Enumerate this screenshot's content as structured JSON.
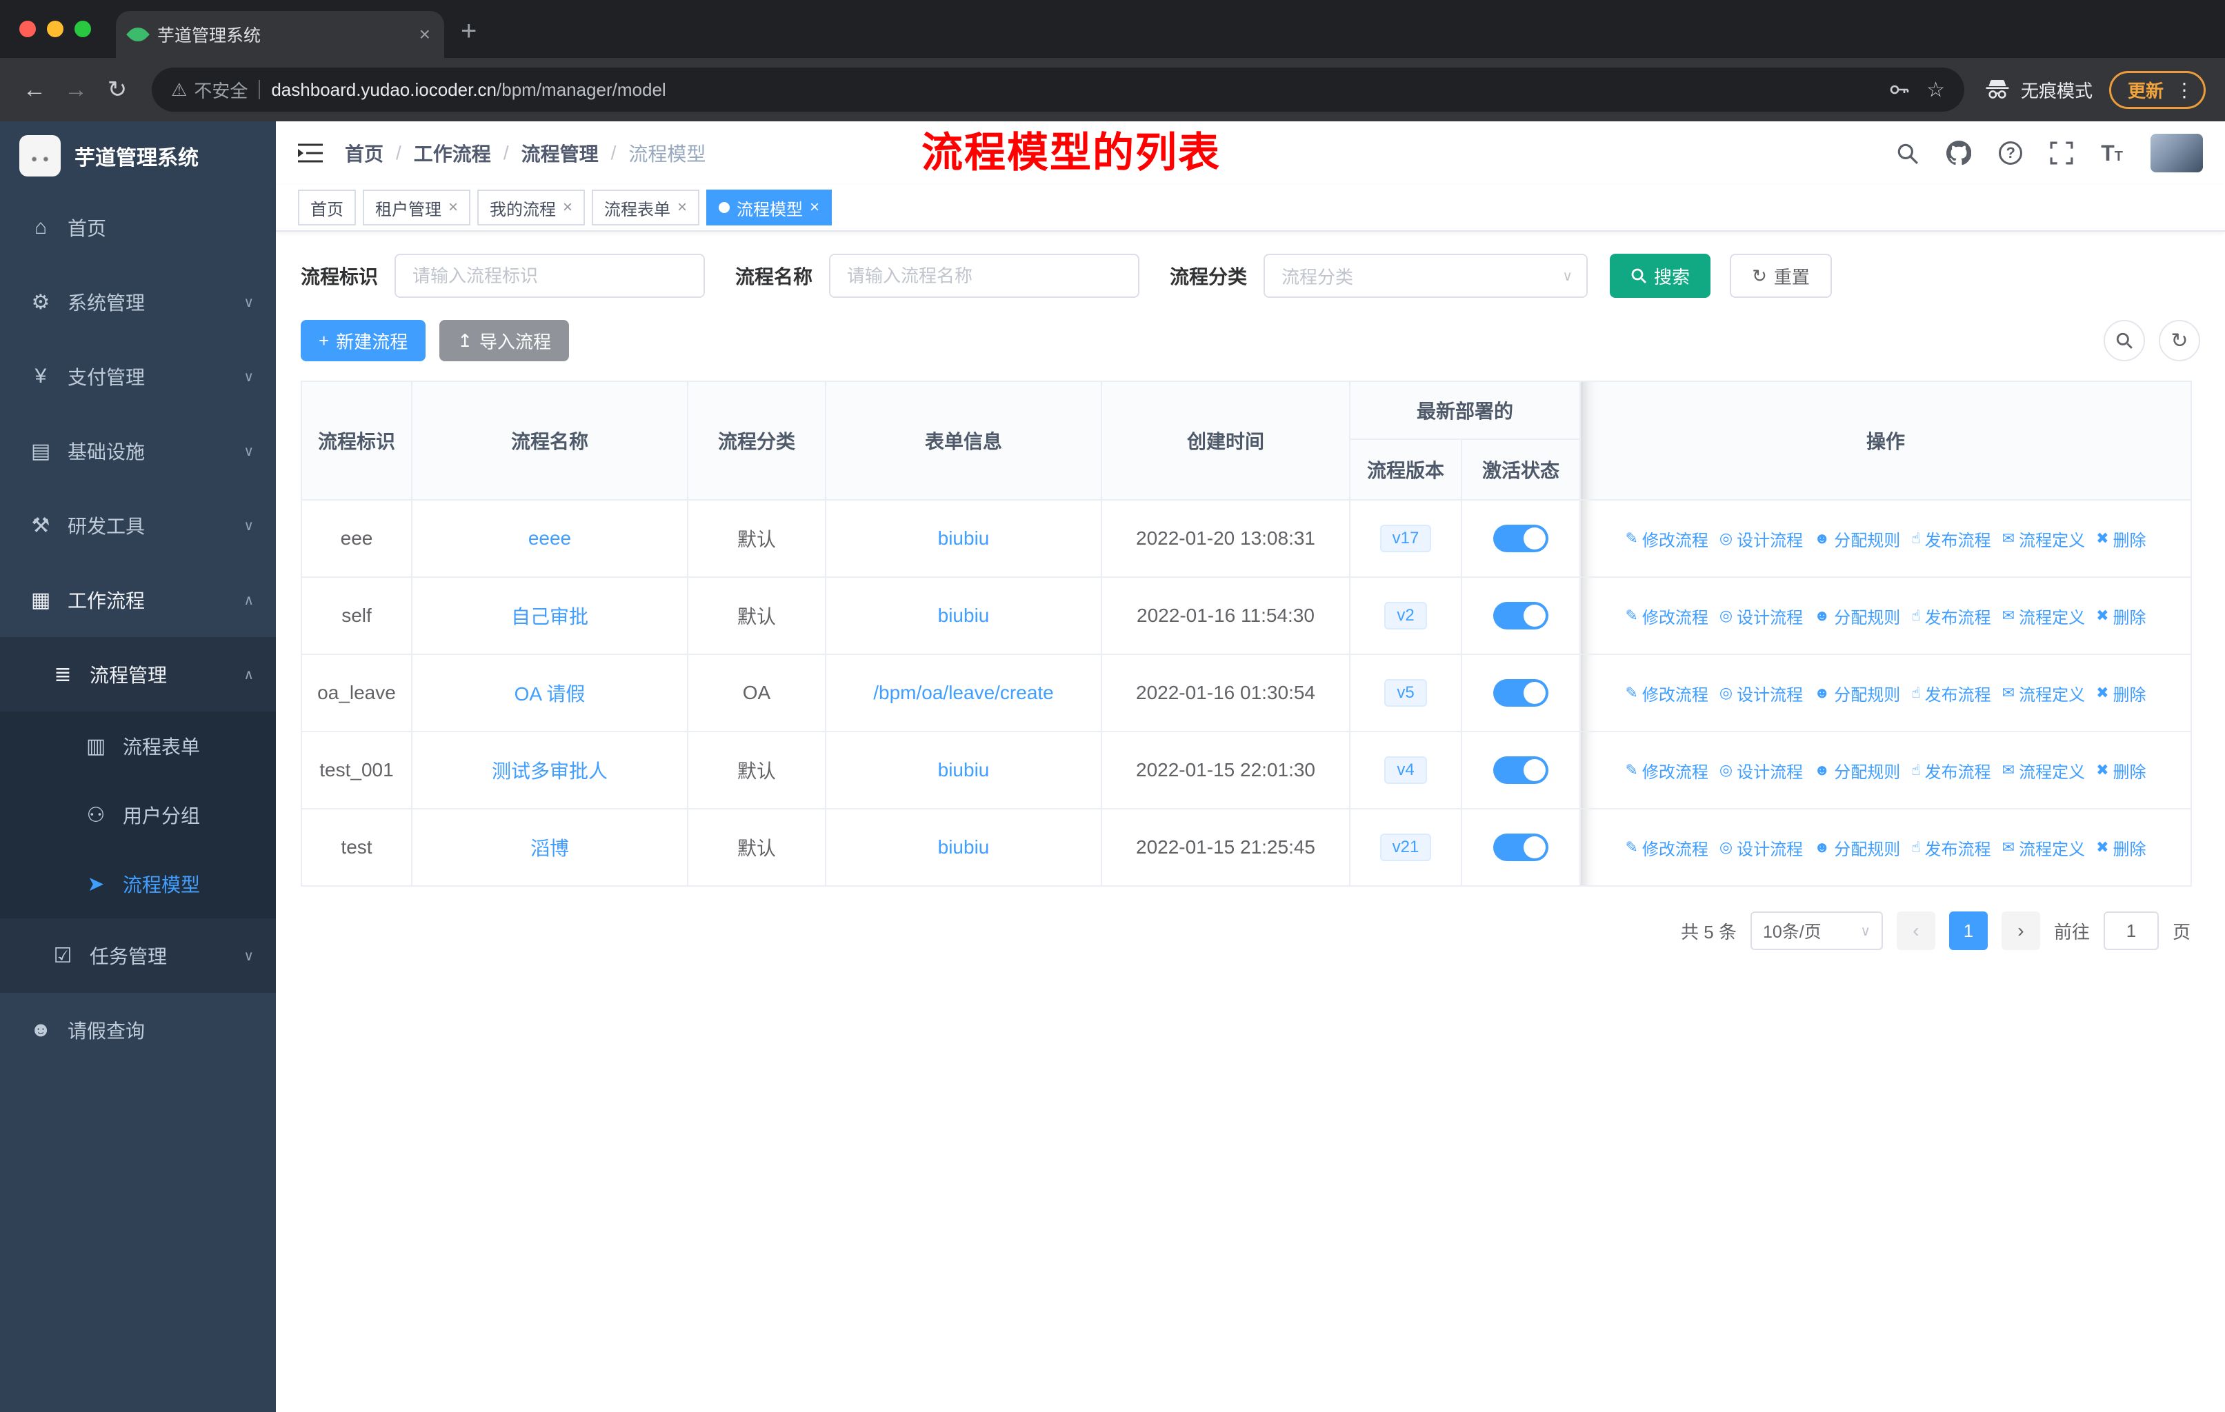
{
  "colors": {
    "accent": "#409eff",
    "search_button": "#11a983",
    "annotation_red": "#ff0000",
    "sidebar_bg": "#304156",
    "import_button": "#909399",
    "version_badge_bg": "#ecf5ff"
  },
  "browser": {
    "tab_title": "芋道管理系统",
    "security_label": "不安全",
    "url_host": "dashboard.yudao.iocoder.cn",
    "url_path": "/bpm/manager/model",
    "incognito_label": "无痕模式",
    "update_label": "更新"
  },
  "icons": {
    "back": "←",
    "forward": "→",
    "reload": "↻",
    "warning": "⚠",
    "star": "☆",
    "new_tab": "+",
    "tab_close": "×",
    "menu_dots": "⋮",
    "chevron_down": "∨",
    "chevron_up": "∧",
    "caret": "∨",
    "breadcrumb_sep": "/",
    "question": "?",
    "font_large": "T",
    "font_small": "T",
    "plus": "+",
    "upload": "↥",
    "refresh": "↻",
    "pg_prev": "‹",
    "pg_next": "›",
    "tag_close": "×"
  },
  "sidebar": {
    "logo_title": "芋道管理系统",
    "items": [
      {
        "label": "首页",
        "icon": "⌂"
      },
      {
        "label": "系统管理",
        "icon": "⚙"
      },
      {
        "label": "支付管理",
        "icon": "¥"
      },
      {
        "label": "基础设施",
        "icon": "▤"
      },
      {
        "label": "研发工具",
        "icon": "⚒"
      },
      {
        "label": "工作流程",
        "icon": "▦"
      },
      {
        "label": "流程管理",
        "icon": "≣"
      },
      {
        "label": "流程表单",
        "icon": "▥"
      },
      {
        "label": "用户分组",
        "icon": "⚇"
      },
      {
        "label": "流程模型",
        "icon": "➤"
      },
      {
        "label": "任务管理",
        "icon": "☑"
      },
      {
        "label": "请假查询",
        "icon": "☻"
      }
    ]
  },
  "header": {
    "breadcrumb": [
      "首页",
      "工作流程",
      "流程管理",
      "流程模型"
    ],
    "annotation": "流程模型的列表"
  },
  "tags": {
    "items": [
      {
        "label": "首页"
      },
      {
        "label": "租户管理"
      },
      {
        "label": "我的流程"
      },
      {
        "label": "流程表单"
      },
      {
        "label": "流程模型"
      }
    ]
  },
  "filters": {
    "id_label": "流程标识",
    "id_placeholder": "请输入流程标识",
    "name_label": "流程名称",
    "name_placeholder": "请输入流程名称",
    "category_label": "流程分类",
    "category_placeholder": "流程分类",
    "search_label": "搜索",
    "reset_label": "重置"
  },
  "toolbar": {
    "create_label": "新建流程",
    "import_label": "导入流程"
  },
  "table": {
    "headers": {
      "id": "流程标识",
      "name": "流程名称",
      "category": "流程分类",
      "form": "表单信息",
      "created": "创建时间",
      "deploy_group": "最新部署的",
      "version": "流程版本",
      "status": "激活状态",
      "ops": "操作"
    },
    "actions": [
      {
        "name": "modify-process",
        "icon": "✎",
        "label": "修改流程"
      },
      {
        "name": "design-process",
        "icon": "◎",
        "label": "设计流程"
      },
      {
        "name": "assign-rule",
        "icon": "☻",
        "label": "分配规则"
      },
      {
        "name": "publish-process",
        "icon": "☝",
        "label": "发布流程"
      },
      {
        "name": "process-definition",
        "icon": "✉",
        "label": "流程定义"
      },
      {
        "name": "delete",
        "icon": "✖",
        "label": "删除"
      }
    ],
    "rows": [
      {
        "id": "eee",
        "name": "eeee",
        "category": "默认",
        "form": "biubiu",
        "created": "2022-01-20 13:08:31",
        "version": "v17",
        "active": true
      },
      {
        "id": "self",
        "name": "自己审批",
        "category": "默认",
        "form": "biubiu",
        "created": "2022-01-16 11:54:30",
        "version": "v2",
        "active": true
      },
      {
        "id": "oa_leave",
        "name": "OA 请假",
        "category": "OA",
        "form": "/bpm/oa/leave/create",
        "created": "2022-01-16 01:30:54",
        "version": "v5",
        "active": true
      },
      {
        "id": "test_001",
        "name": "测试多审批人",
        "category": "默认",
        "form": "biubiu",
        "created": "2022-01-15 22:01:30",
        "version": "v4",
        "active": true
      },
      {
        "id": "test",
        "name": "滔博",
        "category": "默认",
        "form": "biubiu",
        "created": "2022-01-15 21:25:45",
        "version": "v21",
        "active": true
      }
    ]
  },
  "pagination": {
    "total": "共 5 条",
    "page_size": "10条/页",
    "current": "1",
    "goto_label": "前往",
    "page_unit": "页"
  }
}
